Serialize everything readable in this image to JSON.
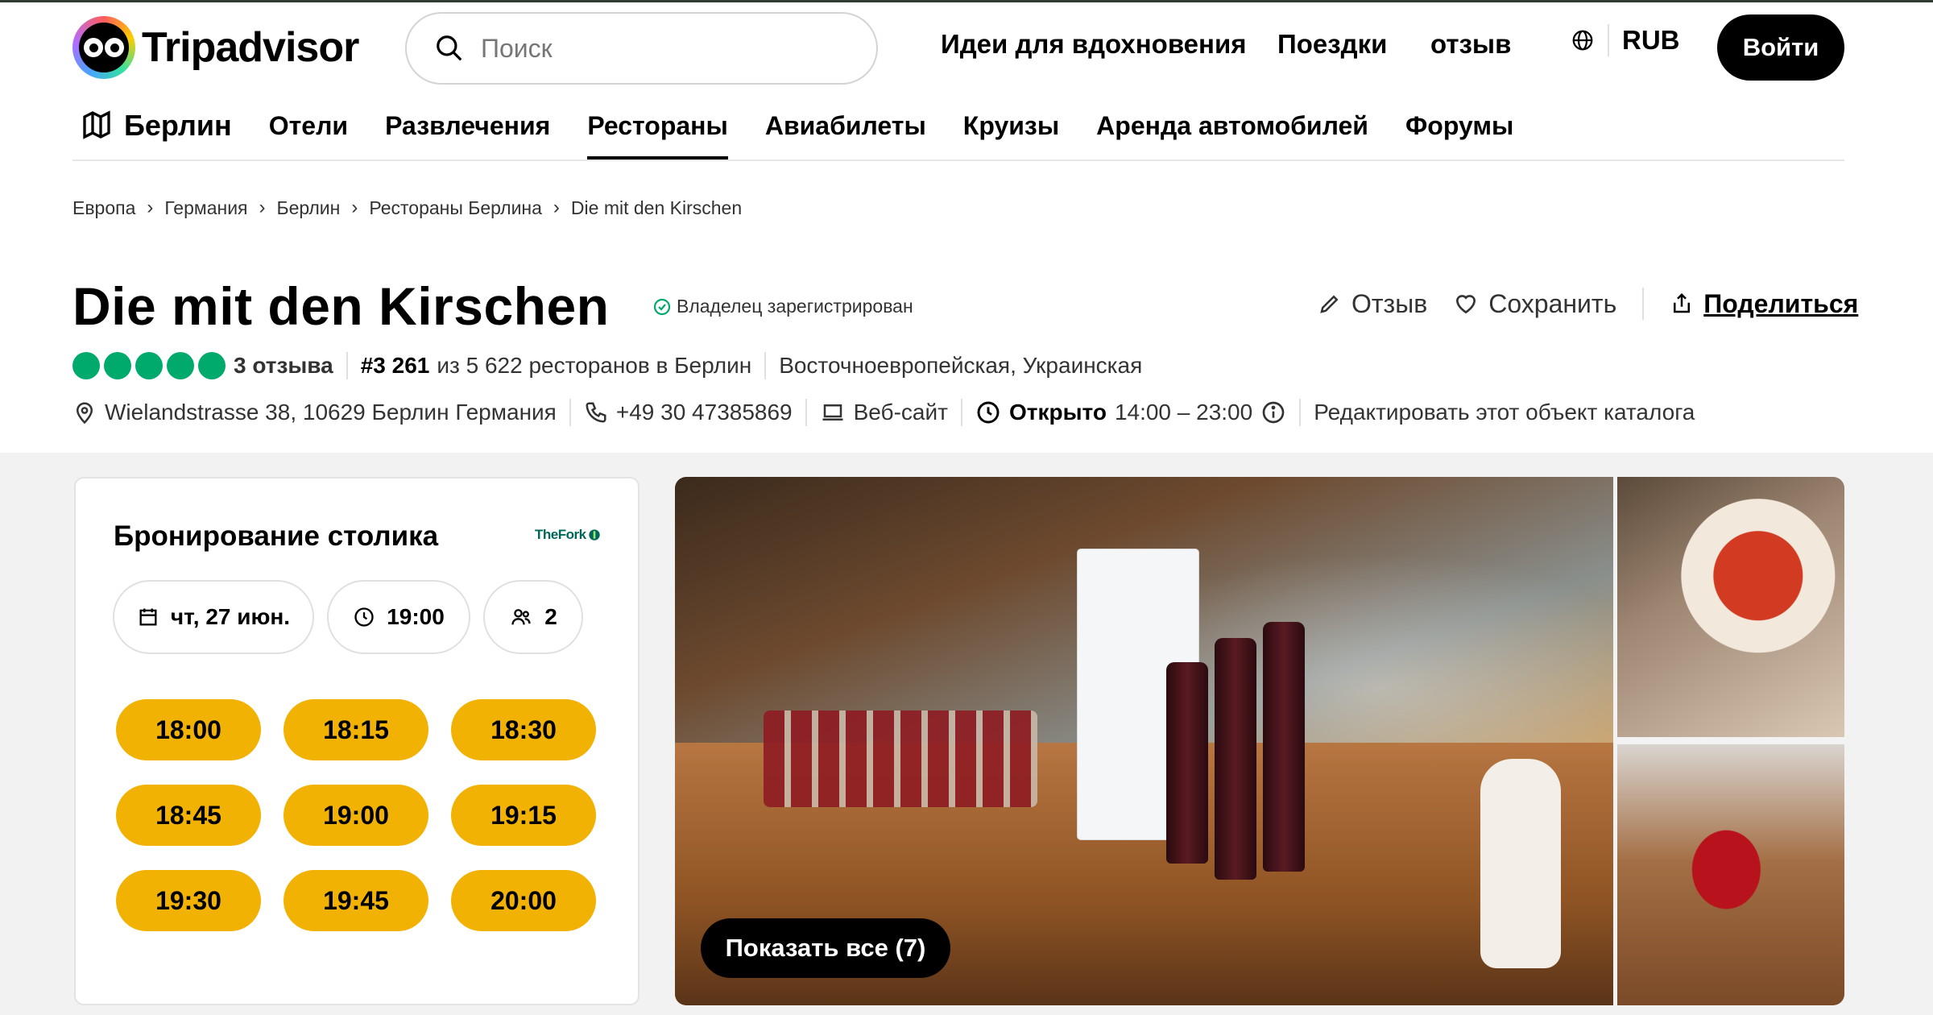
{
  "header": {
    "logo_text": "Tripadvisor",
    "search_placeholder": "Поиск",
    "nav": [
      "Идеи для вдохновения",
      "Поездки",
      "отзыв"
    ],
    "currency": "RUB",
    "login": "Войти"
  },
  "subnav": {
    "city": "Берлин",
    "items": [
      "Отели",
      "Развлечения",
      "Рестораны",
      "Авиабилеты",
      "Круизы",
      "Аренда автомобилей",
      "Форумы"
    ],
    "active": "Рестораны"
  },
  "breadcrumbs": [
    "Европа",
    "Германия",
    "Берлин",
    "Рестораны Берлина",
    "Die mit den Kirschen"
  ],
  "restaurant": {
    "name": "Die mit den Kirschen",
    "owner_status": "Владелец зарегистрирован",
    "rating": 5,
    "reviews": "3 отзыва",
    "rank": "#3 261",
    "rank_suffix": "из 5 622 ресторанов в Берлин",
    "cuisine": "Восточноевропейская, Украинская",
    "address": "Wielandstrasse 38, 10629 Берлин Германия",
    "phone": "+49 30 47385869",
    "website": "Веб-сайт",
    "open_label": "Открыто",
    "hours": "14:00 – 23:00",
    "edit_link": "Редактировать этот объект каталога"
  },
  "actions": {
    "review": "Отзыв",
    "save": "Сохранить",
    "share": "Поделиться"
  },
  "booking": {
    "title": "Бронирование столика",
    "partner": "TheFork",
    "date": "чт, 27 июн.",
    "time": "19:00",
    "guests": "2",
    "slots": [
      "18:00",
      "18:15",
      "18:30",
      "18:45",
      "19:00",
      "19:15",
      "19:30",
      "19:45",
      "20:00"
    ]
  },
  "photos": {
    "show_all": "Показать все (7)"
  },
  "colors": {
    "accent": "#000000",
    "rating": "#00aa6c",
    "slot": "#f2b203",
    "background_gray": "#f2f2f2"
  }
}
